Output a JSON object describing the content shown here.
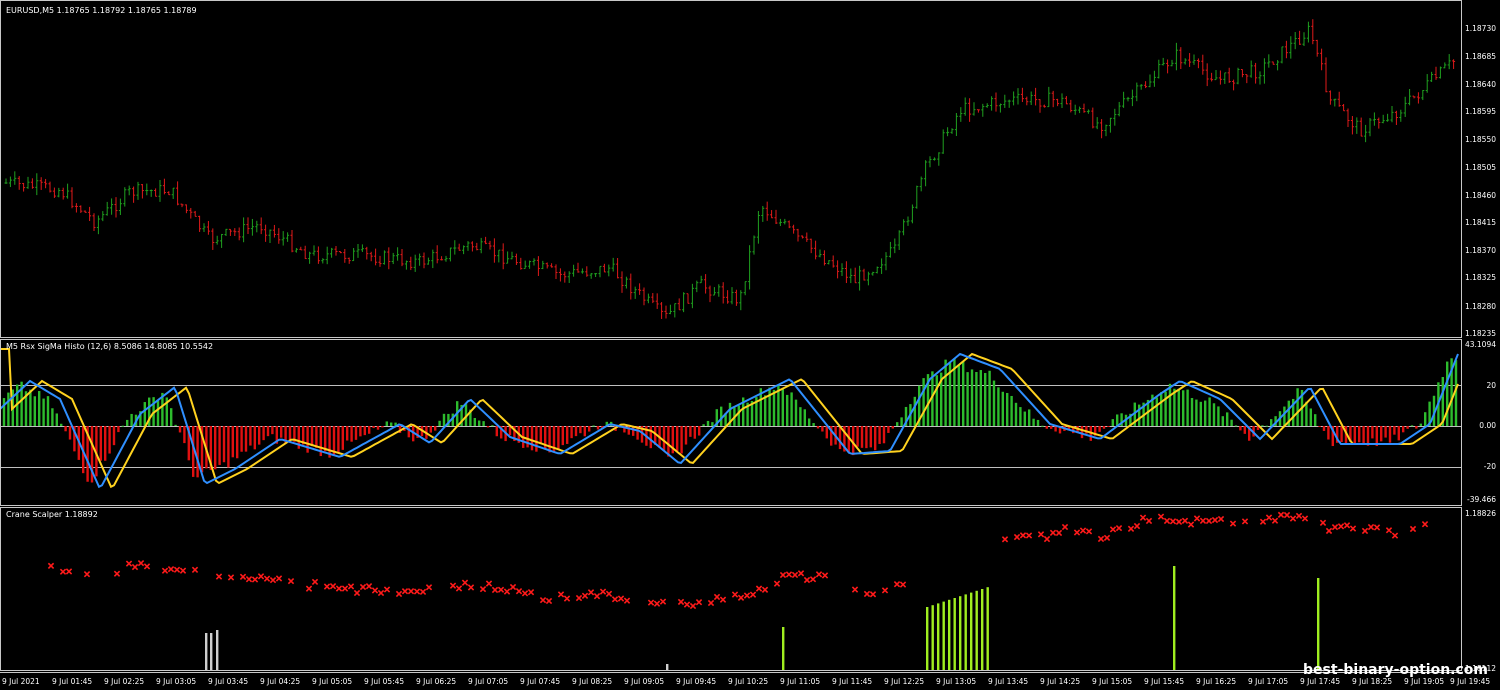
{
  "chart": {
    "symbol_label": "EURUSD,M5  1.18765 1.18792 1.18765 1.18789",
    "price_ticks": [
      "1.18730",
      "1.18685",
      "1.18640",
      "1.18595",
      "1.18550",
      "1.18505",
      "1.18460",
      "1.18415",
      "1.18370",
      "1.18325",
      "1.18280",
      "1.18235"
    ],
    "colors": {
      "background": "#000000",
      "bull": "#1fa01f",
      "bear": "#e01a1a",
      "grid": "#c8c8c8"
    }
  },
  "indicator1": {
    "label": "M5  Rsx SigMa Histo (12,6) 8.5086 14.8085 10.5542",
    "ticks": [
      "43.1094",
      "20",
      "0.00",
      "-20",
      "-39.466"
    ],
    "colors": {
      "pos": "#2dbb2d",
      "neg": "#e01010",
      "fast": "#2f8fff",
      "slow": "#ffd21f"
    }
  },
  "indicator2": {
    "label": "Crane Scalper 1.18892",
    "ticks": [
      "1.18826",
      "1.18112"
    ],
    "colors": {
      "marker": "#ff1a1a",
      "bar_green": "#a0ee20",
      "bar_white": "#cfcfcf"
    }
  },
  "time_axis": [
    "9 Jul 2021",
    "9 Jul 01:45",
    "9 Jul 02:25",
    "9 Jul 03:05",
    "9 Jul 03:45",
    "9 Jul 04:25",
    "9 Jul 05:05",
    "9 Jul 05:45",
    "9 Jul 06:25",
    "9 Jul 07:05",
    "9 Jul 07:45",
    "9 Jul 08:25",
    "9 Jul 09:05",
    "9 Jul 09:45",
    "9 Jul 10:25",
    "9 Jul 11:05",
    "9 Jul 11:45",
    "9 Jul 12:25",
    "9 Jul 13:05",
    "9 Jul 13:45",
    "9 Jul 14:25",
    "9 Jul 15:05",
    "9 Jul 15:45",
    "9 Jul 16:25",
    "9 Jul 17:05",
    "9 Jul 17:45",
    "9 Jul 18:25",
    "9 Jul 19:05",
    "9 Jul 19:45"
  ],
  "watermark": "best-binary-option.com"
}
